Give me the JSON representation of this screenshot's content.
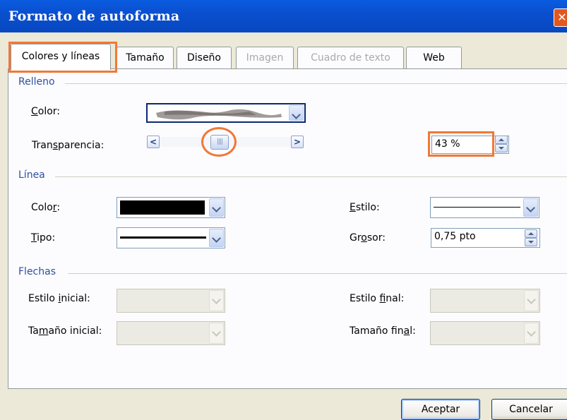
{
  "window": {
    "title": "Formato de autoforma",
    "close_glyph": "✕"
  },
  "tabs": [
    {
      "label": "Colores y líneas",
      "active": true,
      "enabled": true
    },
    {
      "label": "Tamaño",
      "active": false,
      "enabled": true
    },
    {
      "label": "Diseño",
      "active": false,
      "enabled": true
    },
    {
      "label": "Imagen",
      "active": false,
      "enabled": false
    },
    {
      "label": "Cuadro de texto",
      "active": false,
      "enabled": false
    },
    {
      "label": "Web",
      "active": false,
      "enabled": true
    }
  ],
  "relleno": {
    "heading": "Relleno",
    "color_label": "Color:",
    "transparency_label": "Transparencia:",
    "transparency_value": "43 %",
    "transparency_fraction": 0.43
  },
  "linea": {
    "heading": "Línea",
    "color_label": "Color:",
    "color_value": "#000000",
    "tipo_label": "Tipo:",
    "estilo_label": "Estilo:",
    "grosor_label": "Grosor:",
    "grosor_value": "0,75 pto"
  },
  "flechas": {
    "heading": "Flechas",
    "estilo_inicial_label": "Estilo inicial:",
    "tamano_inicial_label": "Tamaño inicial:",
    "estilo_final_label": "Estilo final:",
    "tamano_final_label": "Tamaño final:"
  },
  "buttons": {
    "ok": "Aceptar",
    "cancel": "Cancelar"
  },
  "colors": {
    "highlight": "#F07838",
    "titlebar": "#0A5CE0",
    "section": "#2E4FA0"
  },
  "icons": {
    "scroll_left": "chevron-left-icon",
    "scroll_right": "chevron-right-icon",
    "thumb": "grip-icon"
  }
}
